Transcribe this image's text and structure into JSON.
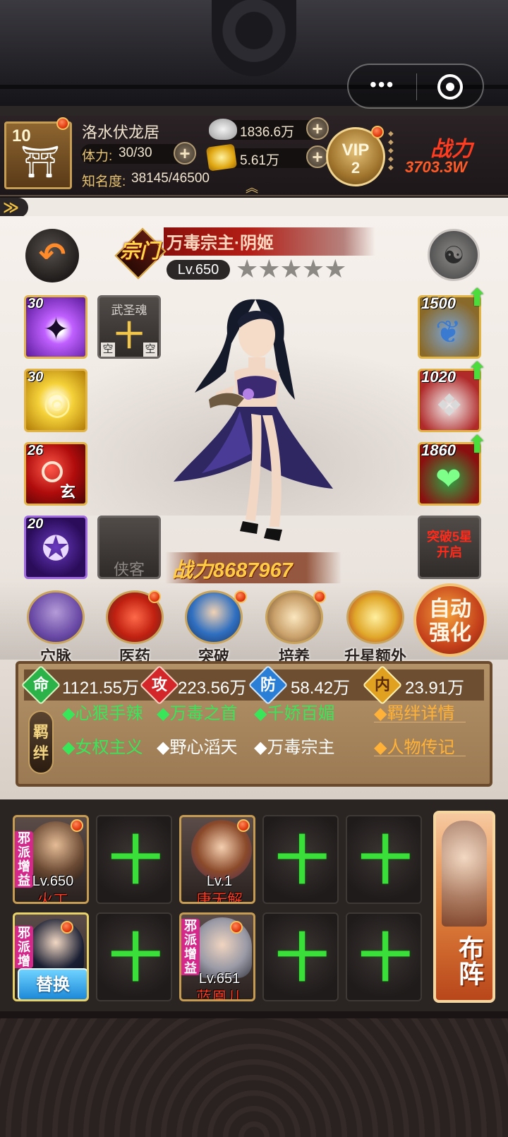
{
  "header": {
    "capsule_dots": "•••"
  },
  "player": {
    "level": "10",
    "name": "洛水伏龙居",
    "stamina_label": "体力:",
    "stamina_value": "30/30",
    "fame_label": "知名度:",
    "fame_value": "38145/46500",
    "silver": "1836.6万",
    "gold": "5.61万",
    "vip_label": "VIP",
    "vip_level": "2",
    "power_label": "战力",
    "power_value": "3703.3W"
  },
  "character": {
    "title": "万毒宗主·阴姬",
    "crest": "宗门",
    "level": "Lv.650",
    "stars": "★★★★★",
    "power": "战力8687967",
    "skills": [
      {
        "level": "30",
        "glyph": "✦",
        "name": "poison-claw-skill"
      },
      {
        "level": "30",
        "glyph": "◎",
        "name": "golden-swirl-skill"
      },
      {
        "level": "26",
        "glyph": "玄",
        "name": "red-spirit-skill"
      },
      {
        "level": "20",
        "glyph": "✪",
        "name": "purple-shuriken-skill"
      }
    ],
    "martial_soul_label": "武圣魂",
    "martial_soul_plus": "十",
    "empty_left": "空",
    "empty_right": "空",
    "retainer_label": "侠客",
    "equipment": [
      {
        "value": "1500",
        "glyph": "❦"
      },
      {
        "value": "1020",
        "glyph": "❖"
      },
      {
        "value": "1860",
        "glyph": "❤"
      }
    ],
    "breakthrough_slot": "突破5星开启"
  },
  "menu": [
    {
      "label": "穴脉",
      "icon": "meridian-icon"
    },
    {
      "label": "医药",
      "icon": "medicine-icon"
    },
    {
      "label": "突破",
      "icon": "breakthrough-icon"
    },
    {
      "label": "培养",
      "icon": "cultivate-icon"
    },
    {
      "label": "升星额外",
      "icon": "star-up-icon"
    }
  ],
  "auto_button": {
    "line1": "自动",
    "line2": "强化"
  },
  "stats": [
    {
      "badge": "命",
      "value": "1121.55万",
      "color": "#2bb34a"
    },
    {
      "badge": "攻",
      "value": "223.56万",
      "color": "#d3262a"
    },
    {
      "badge": "防",
      "value": "58.42万",
      "color": "#2a7ed6"
    },
    {
      "badge": "内",
      "value": "23.91万",
      "color": "#e0a020"
    }
  ],
  "bonds": {
    "tag": "羁绊",
    "row1": [
      "◆心狠手辣",
      "◆万毒之首",
      "◆千娇百媚"
    ],
    "row2": [
      "◆女权主义",
      "◆野心滔天",
      "◆万毒宗主"
    ],
    "details": "◆羁绊详情",
    "biography": "◆人物传记"
  },
  "team": {
    "row1": [
      {
        "type": "hero",
        "level": "Lv.650",
        "name": "火工",
        "tag": "邪派增益"
      },
      {
        "type": "empty"
      },
      {
        "type": "hero",
        "level": "Lv.1",
        "name": "唐无解",
        "tag": ""
      },
      {
        "type": "empty"
      },
      {
        "type": "empty"
      }
    ],
    "row2": [
      {
        "type": "hero",
        "level": "",
        "name": "",
        "tag": "邪派增",
        "swap": "替换"
      },
      {
        "type": "empty"
      },
      {
        "type": "hero",
        "level": "Lv.651",
        "name": "蓝凰儿",
        "tag": "邪派增益"
      },
      {
        "type": "empty"
      },
      {
        "type": "empty"
      }
    ],
    "plus_glyph": "十",
    "deploy": "布阵"
  }
}
